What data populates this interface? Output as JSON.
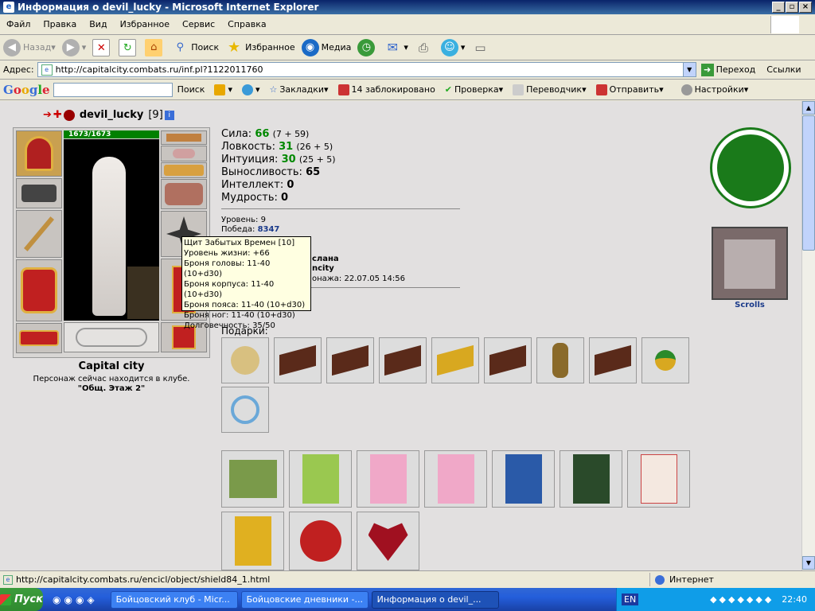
{
  "window": {
    "title": "Информация о devil_lucky - Microsoft Internet Explorer"
  },
  "menu": [
    "Файл",
    "Правка",
    "Вид",
    "Избранное",
    "Сервис",
    "Справка"
  ],
  "toolbar": {
    "back": "Назад",
    "search": "Поиск",
    "favorites": "Избранное",
    "media": "Медиа"
  },
  "address": {
    "label": "Адрес:",
    "url": "http://capitalcity.combats.ru/inf.pl?1122011760",
    "go": "Переход",
    "links": "Ссылки"
  },
  "googlebar": {
    "logo": "Google",
    "search": "Поиск",
    "bookmarks": "Закладки",
    "blocked": "14 заблокировано",
    "check": "Проверка",
    "translator": "Переводчик",
    "send": "Отправить",
    "settings": "Настройки"
  },
  "player": {
    "name": "devil_lucky",
    "level": "[9]",
    "hp": "1673/1673",
    "city": "Capital city",
    "location_text": "Персонаж сейчас находится в клубе.",
    "location_room": "\"Общ. Этаж 2\""
  },
  "stats": [
    {
      "label": "Сила:",
      "value": "66",
      "detail": "(7 + 59)"
    },
    {
      "label": "Ловкость:",
      "value": "31",
      "detail": "(26 + 5)"
    },
    {
      "label": "Интуиция:",
      "value": "30",
      "detail": "(25 + 5)"
    },
    {
      "label": "Выносливость:",
      "value": "65",
      "detail": ""
    },
    {
      "label": "Интеллект:",
      "value": "0",
      "detail": ""
    },
    {
      "label": "Мудрость:",
      "value": "0",
      "detail": ""
    }
  ],
  "info": {
    "level_label": "Уровень:",
    "level_value": "9",
    "wins_label": "Победа:",
    "wins_value": "8347",
    "clan_frag": "слана",
    "city_frag": "ncity",
    "birth_frag": "онажа: 22.07.05 14:56"
  },
  "tooltip": [
    "Щит Забытых Времен [10]",
    "Уровень жизни: +66",
    "Броня головы: 11-40 (10+d30)",
    "Броня корпуса: 11-40 (10+d30)",
    "Броня пояса: 11-40 (10+d30)",
    "Броня ног: 11-40 (10+d30)",
    "Долговечность: 35/50"
  ],
  "gifts_label": "Подарки:",
  "scrolls_label": "Scrolls",
  "status": {
    "url": "http://capitalcity.combats.ru/encicl/object/shield84_1.html",
    "zone": "Интернет"
  },
  "taskbar": {
    "start": "Пуск",
    "tasks": [
      "Бойцовский клуб - Micr...",
      "Бойцовские дневники -...",
      "Информация о devil_..."
    ],
    "lang": "EN",
    "clock": "22:40"
  },
  "colors": {
    "stat_value": "#008000",
    "hp_bar": "#008000",
    "wins": "#1a3a8a",
    "scrolls": "#1a3a8a",
    "emblem": "#1a7a1a"
  }
}
